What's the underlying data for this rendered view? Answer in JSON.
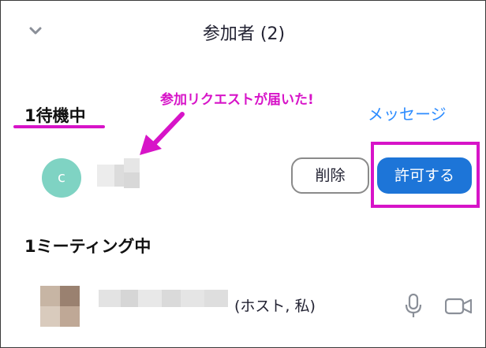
{
  "header": {
    "title": "参加者 (2)",
    "collapse_icon": "chevron-down-icon"
  },
  "waiting": {
    "heading": "1待機中",
    "message_link": "メッセージ",
    "callout": "参加リクエストが届いた!",
    "participant": {
      "avatar_initial": "c",
      "avatar_color": "#7fd3c3"
    },
    "remove_label": "削除",
    "admit_label": "許可する"
  },
  "meeting": {
    "heading": "1ミーティング中",
    "participant": {
      "role_label": "(ホスト, 私)",
      "mic_icon": "microphone-icon",
      "video_icon": "video-camera-icon"
    }
  },
  "colors": {
    "accent": "#1d75d8",
    "link": "#2d8cff",
    "annotation": "#d714c8"
  }
}
